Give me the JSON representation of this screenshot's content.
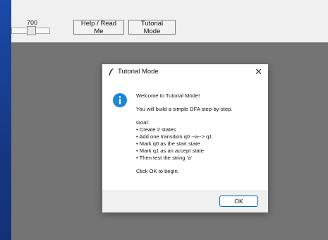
{
  "toolbar": {
    "slider_value": "700",
    "slider_fraction": 0.4,
    "help_label": "Help / Read Me",
    "tutorial_label": "Tutorial Mode"
  },
  "dialog": {
    "title": "Tutorial Mode",
    "title_icon": "feather-icon",
    "close_glyph": "✕",
    "message_icon": "info-icon",
    "welcome": "Welcome to Tutorial Mode!",
    "intro": "You will build a simple DFA step-by-step.",
    "goal_heading": "Goal:",
    "goals": [
      "• Create 2 states",
      "• Add one transition q0 --a--> q1",
      "• Mark q0 as the start state",
      "• Mark q1 as an accept state",
      "• Then test the string 'a'"
    ],
    "closing": "Click OK to begin.",
    "ok_label": "OK"
  },
  "colors": {
    "accent": "#0067c0",
    "info_blue": "#1c86d9",
    "canvas_gray": "#747474"
  }
}
